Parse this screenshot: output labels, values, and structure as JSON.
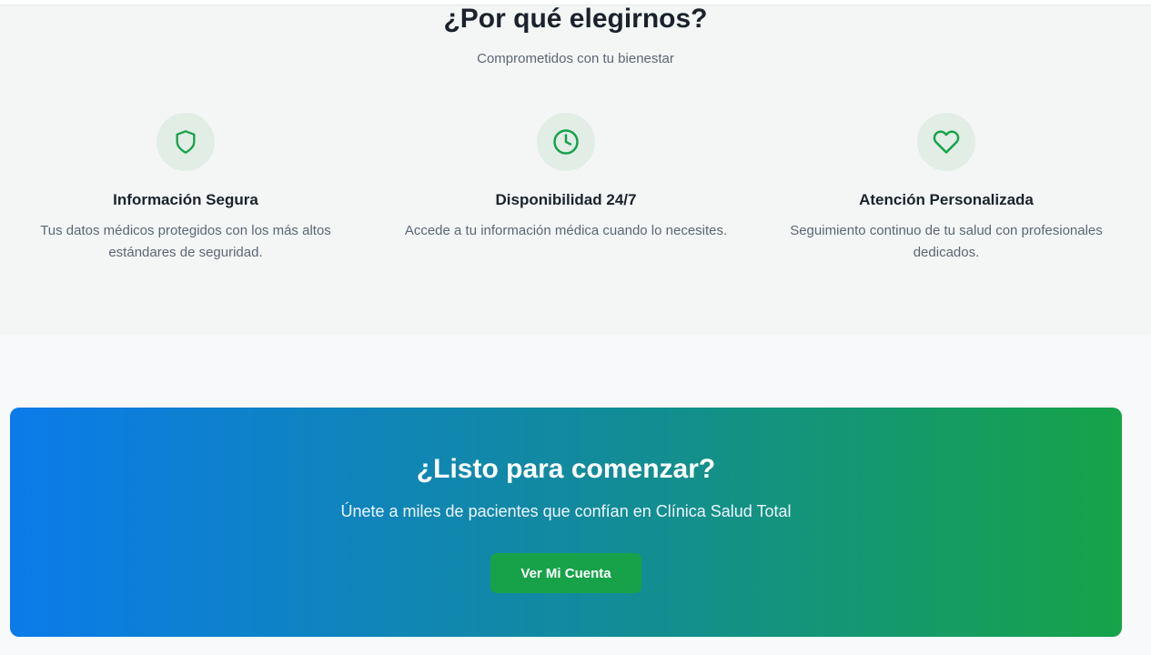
{
  "why": {
    "title": "¿Por qué elegirnos?",
    "subtitle": "Comprometidos con tu bienestar",
    "features": [
      {
        "icon": "shield-icon",
        "title": "Información Segura",
        "description": "Tus datos médicos protegidos con los más altos estándares de seguridad."
      },
      {
        "icon": "clock-icon",
        "title": "Disponibilidad 24/7",
        "description": "Accede a tu información médica cuando lo necesites."
      },
      {
        "icon": "heart-icon",
        "title": "Atención Personalizada",
        "description": "Seguimiento continuo de tu salud con profesionales dedicados."
      }
    ]
  },
  "cta": {
    "title": "¿Listo para comenzar?",
    "subtitle": "Únete a miles de pacientes que confían en Clínica Salud Total",
    "button_label": "Ver Mi Cuenta"
  },
  "colors": {
    "accent_green": "#16a34a",
    "gradient_start": "#0b7bea",
    "gradient_end": "#16a348",
    "icon_bg": "#e2ede6"
  }
}
